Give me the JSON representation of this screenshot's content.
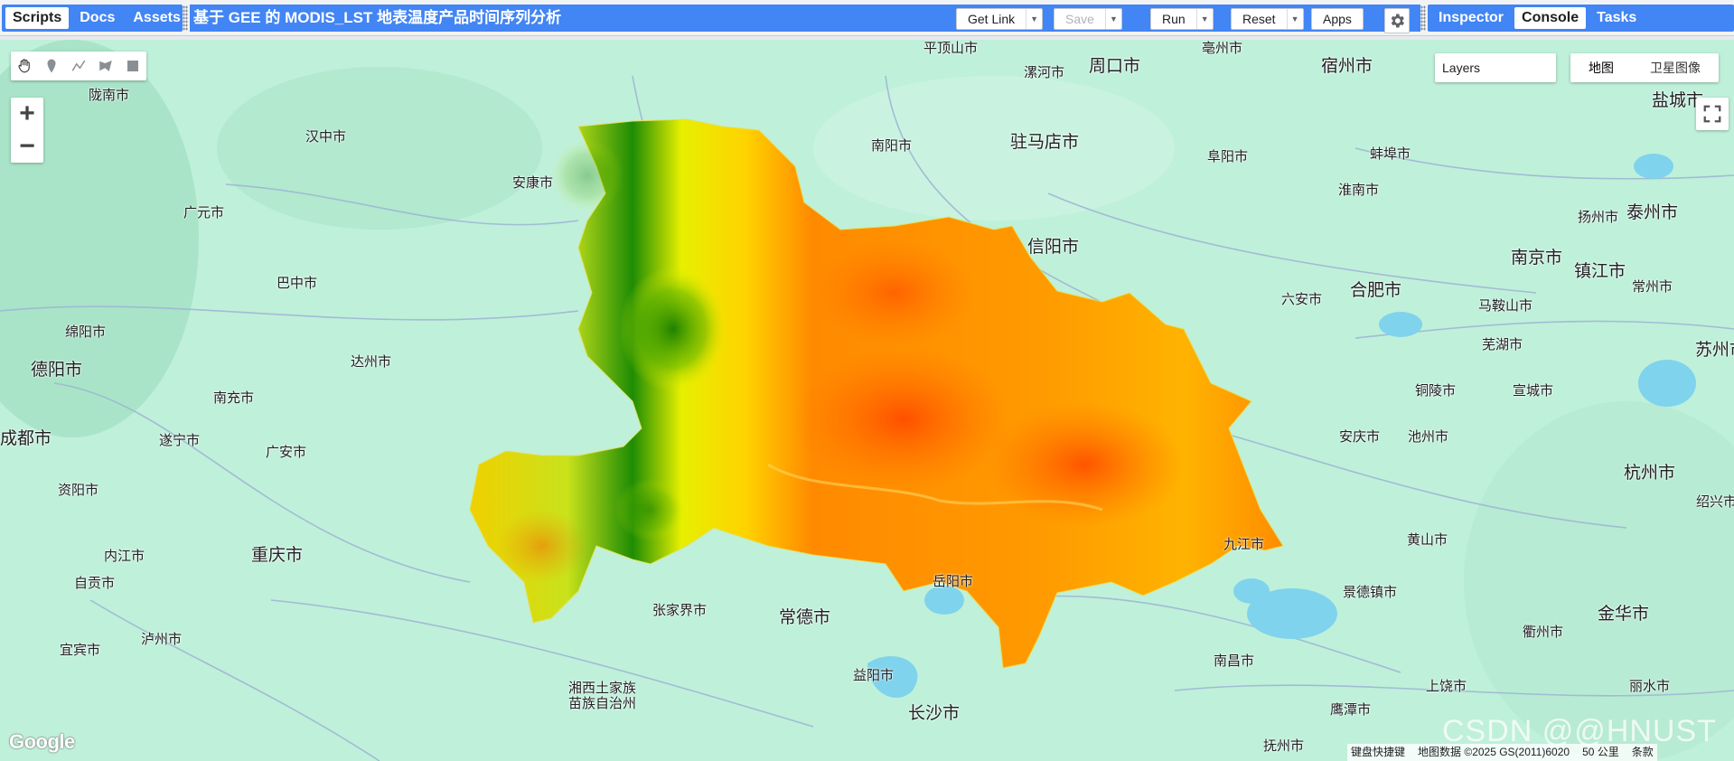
{
  "left_panel_tabs": [
    "Scripts",
    "Docs",
    "Assets"
  ],
  "editor": {
    "title": "基于 GEE 的 MODIS_LST 地表温度产品时间序列分析",
    "get_link": "Get Link",
    "save": "Save",
    "run": "Run",
    "reset": "Reset",
    "apps": "Apps"
  },
  "right_panel_tabs": [
    "Inspector",
    "Console",
    "Tasks"
  ],
  "map": {
    "layers_label": "Layers",
    "map_types": [
      "地图",
      "卫星图像"
    ],
    "zoom_in": "+",
    "zoom_out": "−",
    "logo": "Google",
    "attribution": {
      "shortcuts": "键盘快捷键",
      "data": "地图数据 ©2025 GS(2011)6020",
      "scale": "50 公里",
      "terms": "条款"
    },
    "watermark": "CSDN @@HNUST",
    "cities": [
      "平顶山市",
      "周口市",
      "宿州市",
      "漯河市",
      "亳州市",
      "陇南市",
      "汉中市",
      "南阳市",
      "驻马店市",
      "阜阳市",
      "蚌埠市",
      "盐城市",
      "安康市",
      "淮南市",
      "扬州市",
      "泰州市",
      "广元市",
      "信阳市",
      "南京市",
      "镇江市",
      "巴中市",
      "六安市",
      "合肥市",
      "常州市",
      "马鞍山市",
      "绵阳市",
      "达州市",
      "芜湖市",
      "苏州市",
      "德阳市",
      "南充市",
      "铜陵市",
      "宣城市",
      "成都市",
      "遂宁市",
      "广安市",
      "安庆市",
      "池州市",
      "资阳市",
      "杭州市",
      "绍兴市",
      "内江市",
      "重庆市",
      "九江市",
      "黄山市",
      "自贡市",
      "岳阳市",
      "景德镇市",
      "张家界市",
      "常德市",
      "金华市",
      "宜宾市",
      "泸州市",
      "衢州市",
      "南昌市",
      "益阳市",
      "上饶市",
      "丽水市",
      "湘西土家族",
      "苗族自治州",
      "长沙市",
      "鹰潭市",
      "抚州市"
    ]
  },
  "colors": {
    "panel_blue": "#4285f4",
    "map_water": "#7fd3ec",
    "lst_low": "#1a8a00",
    "lst_mid": "#ffff00",
    "lst_high": "#ff4000"
  }
}
